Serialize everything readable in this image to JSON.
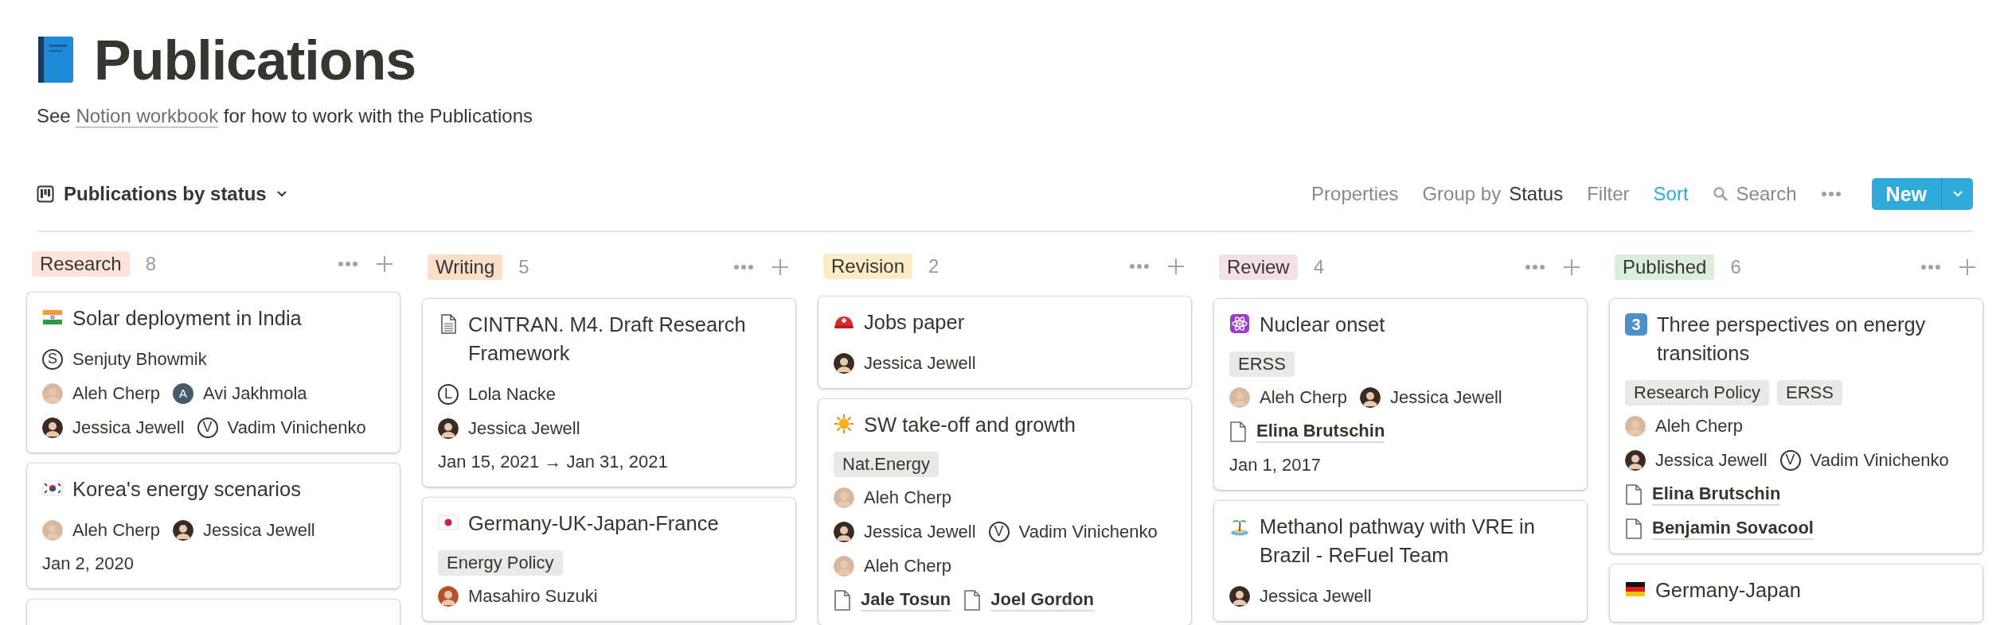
{
  "page": {
    "title": "Publications",
    "link_before": "See",
    "link": "Notion workbook",
    "link_after": "for how to work with the Publications"
  },
  "view": {
    "title": "Publications by status"
  },
  "toolbar": [
    {
      "kind": "text",
      "label": "Properties",
      "active": false
    },
    {
      "kind": "group",
      "label": "Group by",
      "value": "Status",
      "active": false
    },
    {
      "kind": "text",
      "label": "Filter",
      "active": false
    },
    {
      "kind": "text",
      "label": "Sort",
      "active": true
    },
    {
      "kind": "search",
      "label": "Search",
      "active": false
    },
    {
      "kind": "more"
    }
  ],
  "new_button": {
    "label": "New"
  },
  "columns": [
    {
      "label": "Research",
      "count": "8",
      "color": "#ffe2dd",
      "cards": [
        {
          "kind": "flag_in",
          "title": "Solar deployment in India",
          "lines": [
            [
              {
                "kind": "letter",
                "initial": "S",
                "name": "Senjuty Bhowmik"
              }
            ],
            [
              {
                "kind": "photo",
                "color": "#d9b8a0",
                "name": "Aleh Cherp"
              },
              {
                "kind": "filled",
                "initial": "A",
                "name": "Avi Jakhmola"
              }
            ],
            [
              {
                "kind": "photo",
                "color": "#3a2a24",
                "name": "Jessica Jewell"
              },
              {
                "kind": "letter",
                "initial": "V",
                "name": "Vadim Vinichenko"
              }
            ]
          ]
        },
        {
          "kind": "flag_kr",
          "title": "Korea's energy scenarios",
          "lines": [
            [
              {
                "kind": "photo",
                "color": "#d9b8a0",
                "name": "Aleh Cherp"
              },
              {
                "kind": "photo",
                "color": "#3a2a24",
                "name": "Jessica Jewell"
              }
            ]
          ],
          "date": "Jan 2, 2020"
        },
        {
          "kind": "cut"
        }
      ]
    },
    {
      "label": "Writing",
      "count": "5",
      "color": "#fadec9",
      "cards": [
        {
          "kind": "doc",
          "title": "CINTRAN. M4. Draft Research Framework",
          "lines": [
            [
              {
                "kind": "letter",
                "initial": "L",
                "name": "Lola Nacke"
              }
            ],
            [
              {
                "kind": "photo",
                "color": "#3a2a24",
                "name": "Jessica Jewell"
              }
            ]
          ],
          "date": "Jan 15, 2021 → Jan 31, 2021"
        },
        {
          "kind": "flag_jp",
          "title": "Germany-UK-Japan-France",
          "tags": [
            "Energy Policy"
          ],
          "lines": [
            [
              {
                "kind": "photo",
                "color": "#b4532a",
                "name": "Masahiro Suzuki"
              }
            ]
          ]
        }
      ]
    },
    {
      "label": "Revision",
      "count": "2",
      "color": "#fdecc8",
      "cards": [
        {
          "kind": "helmet",
          "title": "Jobs paper",
          "lines": [
            [
              {
                "kind": "photo",
                "color": "#3a2a24",
                "name": "Jessica Jewell"
              }
            ]
          ]
        },
        {
          "kind": "sun",
          "title": "SW take-off and growth",
          "tags": [
            "Nat.Energy"
          ],
          "lines": [
            [
              {
                "kind": "photo",
                "color": "#d9b8a0",
                "name": "Aleh Cherp"
              }
            ],
            [
              {
                "kind": "photo",
                "color": "#3a2a24",
                "name": "Jessica Jewell"
              },
              {
                "kind": "letter",
                "initial": "V",
                "name": "Vadim Vinichenko"
              }
            ],
            [
              {
                "kind": "photo",
                "color": "#d9b8a0",
                "name": "Aleh Cherp"
              }
            ],
            [
              {
                "kind": "page",
                "name": "Jale Tosun"
              },
              {
                "kind": "page",
                "name": "Joel Gordon"
              }
            ]
          ]
        }
      ]
    },
    {
      "label": "Review",
      "count": "4",
      "color": "#f5e0e9",
      "cards": [
        {
          "kind": "atom",
          "title": "Nuclear onset",
          "tags": [
            "ERSS"
          ],
          "lines": [
            [
              {
                "kind": "photo",
                "color": "#d9b8a0",
                "name": "Aleh Cherp"
              },
              {
                "kind": "photo",
                "color": "#3a2a24",
                "name": "Jessica Jewell"
              }
            ],
            [
              {
                "kind": "page",
                "name": "Elina Brutschin"
              }
            ]
          ],
          "date": "Jan 1, 2017"
        },
        {
          "kind": "island",
          "title": "Methanol pathway with VRE in Brazil - ReFuel Team",
          "lines": [
            [
              {
                "kind": "photo",
                "color": "#3a2a24",
                "name": "Jessica Jewell"
              }
            ]
          ]
        }
      ]
    },
    {
      "label": "Published",
      "count": "6",
      "color": "#dbeddb",
      "cards": [
        {
          "kind": "keycap",
          "icon_text": "3",
          "title": "Three perspectives on energy transitions",
          "tags": [
            "Research Policy",
            "ERSS"
          ],
          "lines": [
            [
              {
                "kind": "photo",
                "color": "#d9b8a0",
                "name": "Aleh Cherp"
              }
            ],
            [
              {
                "kind": "photo",
                "color": "#3a2a24",
                "name": "Jessica Jewell"
              },
              {
                "kind": "letter",
                "initial": "V",
                "name": "Vadim Vinichenko"
              }
            ],
            [
              {
                "kind": "page",
                "name": "Elina Brutschin"
              }
            ],
            [
              {
                "kind": "page",
                "name": "Benjamin Sovacool"
              }
            ]
          ]
        },
        {
          "kind": "flag_de",
          "title": "Germany-Japan"
        }
      ]
    }
  ]
}
